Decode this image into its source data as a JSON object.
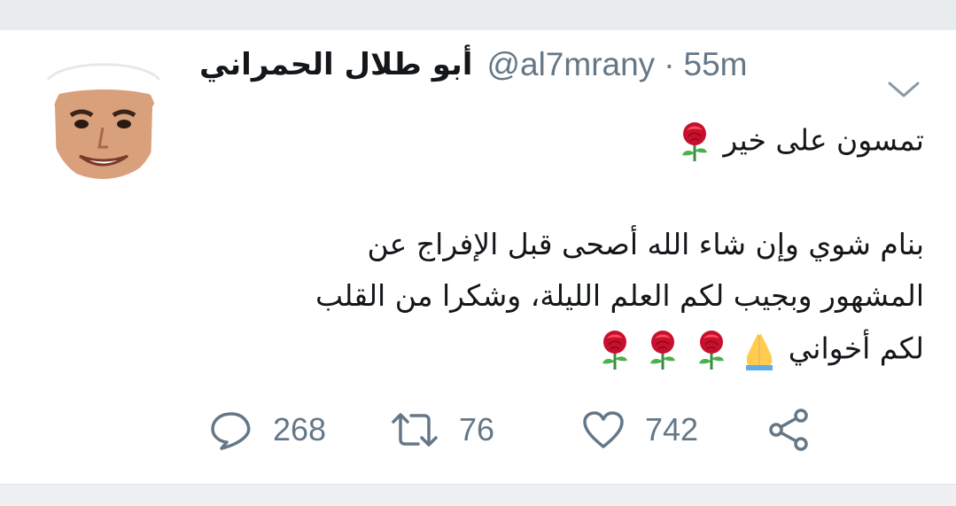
{
  "tweet": {
    "author_name": "أبو طلال الحمراني",
    "handle": "@al7mrany",
    "separator": "·",
    "time": "55m",
    "lines": [
      "تمسون على خير",
      "بنام شوي وإن شاء الله أصحى قبل الإفراج عن",
      "المشهور وبجيب لكم العلم الليلة، وشكرا من القلب",
      "لكم أخواني"
    ],
    "emojis": {
      "line1": [
        "rose-emoji"
      ],
      "line4": [
        "folded-hands-emoji",
        "rose-emoji",
        "rose-emoji",
        "rose-emoji"
      ]
    }
  },
  "actions": {
    "reply_count": "268",
    "retweet_count": "76",
    "like_count": "742",
    "icons": [
      "reply-icon",
      "retweet-icon",
      "like-icon",
      "share-icon"
    ]
  },
  "colors": {
    "text": "#14171a",
    "secondary": "#657786",
    "background_strip": "#e9ecef",
    "rose": "#c8102e",
    "stem": "#3a8c3a"
  }
}
